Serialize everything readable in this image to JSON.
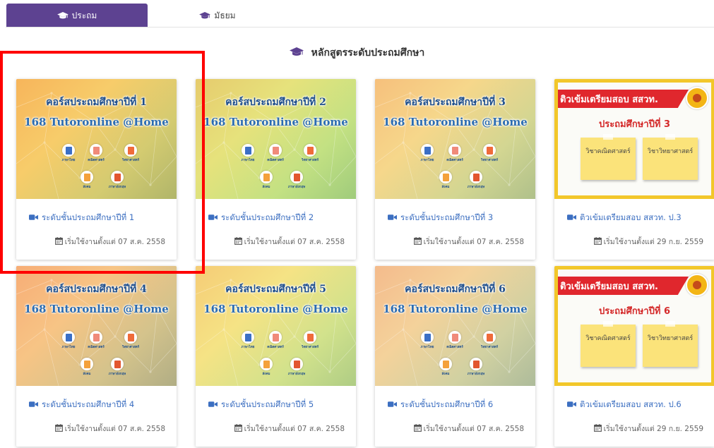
{
  "tabs": [
    {
      "label": "ประถม",
      "icon": "graduation-cap-icon",
      "active": true
    },
    {
      "label": "มัธยม",
      "icon": "graduation-cap-icon",
      "active": false
    }
  ],
  "section": {
    "title": "หลักสูตรระดับประถมศึกษา",
    "icon": "graduation-cap-icon"
  },
  "thumb_tutor": {
    "line2": "168 Tutoronline @Home"
  },
  "thumb_onet": {
    "banner": "ติวเข้มเตรียมสอบ สสวท.",
    "subject_math": "วิชาคณิตศาสตร์",
    "subject_science": "วิชาวิทยาศาสตร์"
  },
  "cards": [
    {
      "type": "tutor",
      "thumb_title": "คอร์สประถมศึกษาปีที่ 1",
      "tint": "#f8c46a",
      "title": "ระดับชั้นประถมศึกษาปีที่ 1",
      "date": "เริ่มใช้งานตั้งแต่ 07 ส.ค. 2558"
    },
    {
      "type": "tutor",
      "thumb_title": "คอร์สประถมศึกษาปีที่ 2",
      "tint": "#d8ec8a",
      "title": "ระดับชั้นประถมศึกษาปีที่ 2",
      "date": "เริ่มใช้งานตั้งแต่ 07 ส.ค. 2558"
    },
    {
      "type": "tutor",
      "thumb_title": "คอร์สประถมศึกษาปีที่ 3",
      "tint": "#f6d9a6",
      "title": "ระดับชั้นประถมศึกษาปีที่ 3",
      "date": "เริ่มใช้งานตั้งแต่ 07 ส.ค. 2558"
    },
    {
      "type": "onet",
      "thumb_grade": "ประถมศึกษาปีที่ 3",
      "title": "ติวเข้มเตรียมสอบ สสวท. ป.3",
      "date": "เริ่มใช้งานตั้งแต่ 29 ก.ย. 2559"
    },
    {
      "type": "tutor",
      "thumb_title": "คอร์สประถมศึกษาปีที่ 4",
      "tint": "#f7b79a",
      "title": "ระดับชั้นประถมศึกษาปีที่ 4",
      "date": "เริ่มใช้งานตั้งแต่ 07 ส.ค. 2558"
    },
    {
      "type": "tutor",
      "thumb_title": "คอร์สประถมศึกษาปีที่ 5",
      "tint": "#f4ee9a",
      "title": "ระดับชั้นประถมศึกษาปีที่ 5",
      "date": "เริ่มใช้งานตั้งแต่ 07 ส.ค. 2558"
    },
    {
      "type": "tutor",
      "thumb_title": "คอร์สประถมศึกษาปีที่ 6",
      "tint": "#f3cfc2",
      "title": "ระดับชั้นประถมศึกษาปีที่ 6",
      "date": "เริ่มใช้งานตั้งแต่ 07 ส.ค. 2558"
    },
    {
      "type": "onet",
      "thumb_grade": "ประถมศึกษาปีที่ 6",
      "title": "ติวเข้มเตรียมสอบ สสวท. ป.6",
      "date": "เริ่มใช้งานตั้งแต่ 29 ก.ย. 2559"
    }
  ],
  "colors": {
    "tab_active": "#5d4291",
    "link": "#3c6fc1",
    "highlight": "#ff0000"
  }
}
